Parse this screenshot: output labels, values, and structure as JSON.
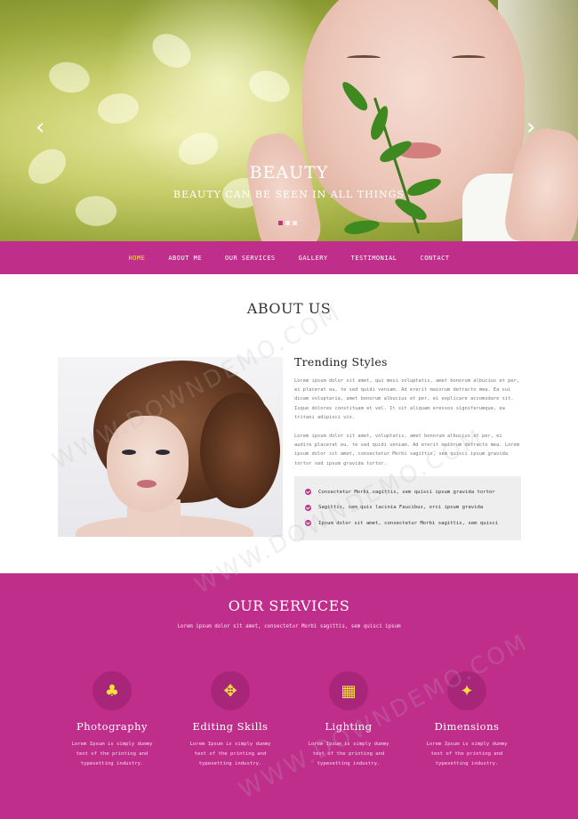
{
  "hero": {
    "title": "BEAUTY",
    "subtitle": "BEAUTY CAN BE SEEN IN ALL THINGS",
    "prev_arrow": "‹",
    "next_arrow": "›",
    "slide_count": 3,
    "active_slide": 1
  },
  "nav": {
    "items": [
      {
        "label": "HOME",
        "active": true
      },
      {
        "label": "ABOUT ME",
        "active": false
      },
      {
        "label": "OUR SERVICES",
        "active": false
      },
      {
        "label": "GALLERY",
        "active": false
      },
      {
        "label": "TESTIMONIAL",
        "active": false
      },
      {
        "label": "CONTACT",
        "active": false
      }
    ]
  },
  "about": {
    "title": "ABOUT US",
    "heading": "Trending Styles",
    "paragraph1": "Lorem ipsum dolor sit amet, qui mesi voluptatis, amet bonorum albucius et per, ei placerat eu, te sed quidi veniam. Ad ererit maiorum detracto mea. Ea sui dicam voluptaria, amet bonorum albucius et per, ei explicare accomodare sit. Isque dolores constituam et vel. It sit aliquam eressos signiferumque, ea tritani adipisci vix.",
    "paragraph2": "Lorem ipsum dolor sit amet, voluptatis, amet bonorum albucius et per, ei audire placerat eu, te sed quidi veniam. Ad ererit maiorum detracto mea. Lorem ipsum dolor sit amet, consectetur Morbi sagittis, sem quisci ipsum gravida tortor sed ipsum gravida tortor.",
    "checklist": [
      "Consectetur Morbi sagittis, sem quisci ipsum gravida tortor",
      "Sagittis, sem quis lacinia Faucibus, orci ipsum gravida",
      "Ipsum dolor sit amet, consectetur Morbi sagittis, sem quisci"
    ]
  },
  "services": {
    "title": "OUR SERVICES",
    "subtitle": "Lorem ipsum dolor sit amet, consectetur Morbi sagittis, sem quisci ipsum",
    "items": [
      {
        "title": "Photography",
        "icon": "tree-icon",
        "glyph": "♣",
        "text": "Lorem Ipsum is simply dummy text of the printing and typesetting industry."
      },
      {
        "title": "Editing Skills",
        "icon": "crosshair-icon",
        "glyph": "✥",
        "text": "Lorem Ipsum is simply dummy text of the printing and typesetting industry."
      },
      {
        "title": "Lighting",
        "icon": "building-icon",
        "glyph": "▦",
        "text": "Lorem Ipsum is simply dummy text of the printing and typesetting industry."
      },
      {
        "title": "Dimensions",
        "icon": "twitter-bird-icon",
        "glyph": "✦",
        "text": "Lorem Ipsum is simply dummy text of the printing and typesetting industry."
      }
    ]
  },
  "watermark": "WWW.DOWNDEMO.COM",
  "colors": {
    "accent": "#c02e8c",
    "active_nav": "#f6e33a",
    "icon_circle": "#a8267a"
  }
}
